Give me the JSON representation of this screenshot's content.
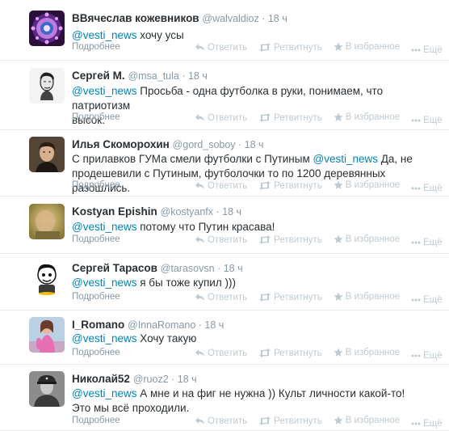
{
  "tweets": [
    {
      "name": "ВВячеслав кожевников",
      "handle": "@walvaldioz",
      "time": "18 ч",
      "mention": "@vesti_news",
      "lines": [
        " хочу усы"
      ],
      "more": "Подробнее",
      "avatar": "mandala"
    },
    {
      "name": "Сергей М.",
      "handle": "@msa_tula",
      "time": "18 ч",
      "mention": "@vesti_news",
      "lines": [
        " Просьба - одна футболка в руки, понимаем, что патриотизм",
        "высок."
      ],
      "more": "Подробнее",
      "avatar": "sketch"
    },
    {
      "name": "Илья Скоморохин",
      "handle": "@gord_soboy",
      "time": "18 ч",
      "prefix": "С прилавков ГУМа смели футболки с Путиным ",
      "mention": "@vesti_news",
      "lines": [
        " Да, не",
        "продешевили с Путиным, футболочки то по 1200 деревянных разошлись."
      ],
      "more": "Подробнее",
      "avatar": "man"
    },
    {
      "name": "Kostyan Epishin",
      "handle": "@kostyanfx",
      "time": "18 ч",
      "mention": "@vesti_news",
      "lines": [
        " потому что Путин красава!"
      ],
      "more": "Подробнее",
      "avatar": "blurry"
    },
    {
      "name": "Сергей Тарасов",
      "handle": "@tarasovsn",
      "time": "18 ч",
      "mention": "@vesti_news",
      "lines": [
        " я бы тоже купил )))"
      ],
      "more": "Подробнее",
      "avatar": "cartoon"
    },
    {
      "name": "I_Romano",
      "handle": "@InnaRomano",
      "time": "18 ч",
      "mention": "@vesti_news",
      "lines": [
        " Хочу такую"
      ],
      "more": "Подробнее",
      "avatar": "pink"
    },
    {
      "name": "Николай52",
      "handle": "@ruoz2",
      "time": "18 ч",
      "mention": "@vesti_news",
      "lines": [
        " А мне и на фиг не нужна )) Культ личности какой-то!",
        "Это мы всё проходили."
      ],
      "more": "Подробнее",
      "avatar": "soldier"
    }
  ],
  "actions": {
    "reply": "Ответить",
    "retweet": "Ретвитнуть",
    "favorite": "В избранное",
    "more": "Ещё"
  },
  "colors": {
    "link": "#0084b4",
    "muted": "#8899a6",
    "action": "#bfcbd3",
    "text": "#292f33"
  }
}
